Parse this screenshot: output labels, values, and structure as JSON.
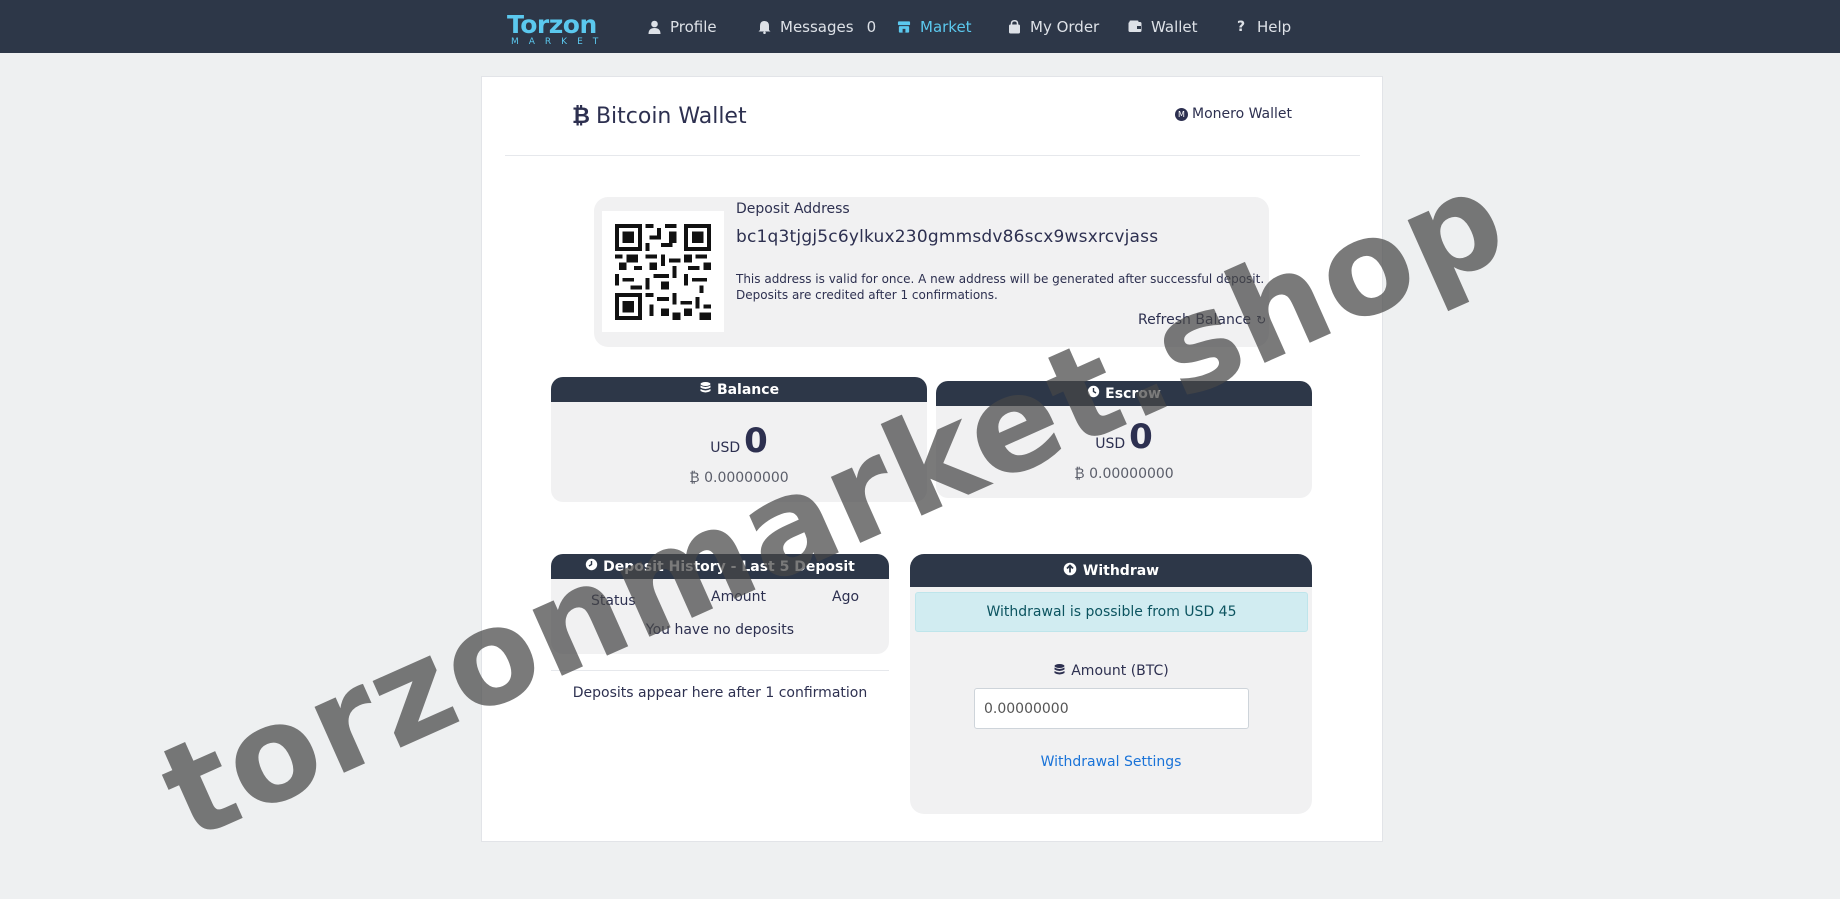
{
  "nav": {
    "logo_main": "Torzon",
    "logo_sub": "MARKET",
    "items": [
      {
        "label": "Profile",
        "icon": "user-icon"
      },
      {
        "label": "Messages",
        "icon": "bell-icon",
        "badge": "0"
      },
      {
        "label": "Market",
        "icon": "store-icon",
        "active": true
      },
      {
        "label": "My Order",
        "icon": "bag-icon"
      },
      {
        "label": "Wallet",
        "icon": "wallet-icon"
      },
      {
        "label": "Help",
        "icon": "question-icon"
      }
    ]
  },
  "wallet": {
    "title": "Bitcoin Wallet",
    "monero_link": "Monero Wallet",
    "deposit_label": "Deposit Address",
    "address": "bc1q3tjgj5c6ylkux230gmmsdv86scx9wsxrcvjass",
    "note_line1": "This address is valid for once. A new address will be generated after successful deposit.",
    "note_line2": "Deposits are credited after 1 confirmations.",
    "refresh": "Refresh Balance"
  },
  "balance": {
    "title": "Balance",
    "currency": "USD",
    "usd": "0",
    "btc": "0.00000000"
  },
  "escrow": {
    "title": "Escrow",
    "currency": "USD",
    "usd": "0",
    "btc": "0.00000000"
  },
  "history": {
    "title": "Deposit History - Last 5 Deposit",
    "columns": [
      "Status",
      "Amount",
      "Ago"
    ],
    "empty": "You have no deposits",
    "footer": "Deposits appear here after 1 confirmation"
  },
  "withdraw": {
    "title": "Withdraw",
    "alert": "Withdrawal is possible from USD 45",
    "amount_label": "Amount (BTC)",
    "amount_value": "0.00000000",
    "settings": "Withdrawal Settings"
  },
  "watermark": "torzonmarket.shop",
  "colors": {
    "nav_bg": "#2d3748",
    "accent": "#5bc8ee",
    "link": "#1a73d8",
    "alert_bg": "#d1ecf1"
  }
}
